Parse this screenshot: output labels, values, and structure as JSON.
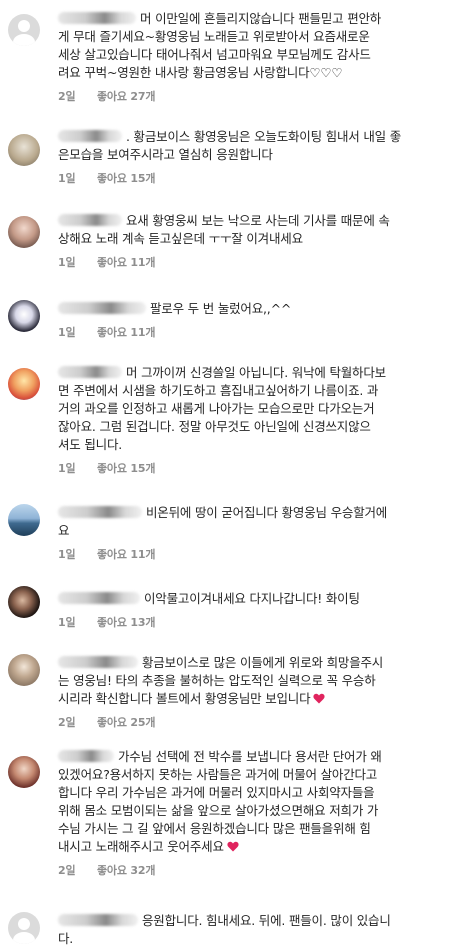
{
  "comments": [
    {
      "text": "머 이만일에 흔들리지않습니다 팬들믿고 편안하\n게 무대 즐기세요~황영웅님 노래듣고 위로받아서 요즘새로운\n세상 살고있습니다 태어나줘서 넘고마워요 부모님께도 감사드\n려요 꾸벅~영원한 내사랑 황금영웅님 사랑합니다♡♡♡",
      "time": "2일",
      "likes": "좋아요 27개"
    },
    {
      "text": ". 황금보이스 황영웅님은 오늘도화이팅 힘내서 내일 좋\n은모습을 보여주시라고 열심히 응원합니다",
      "time": "1일",
      "likes": "좋아요 15개"
    },
    {
      "text": "요새 황영웅씨 보는 낙으로 사는데 기사를 때문에 속\n상해요 노래 계속 듣고싶은데 ㅜㅜ잘 이겨내세요",
      "time": "1일",
      "likes": "좋아요 11개"
    },
    {
      "text": "팔로우 두 번 눌렀어요,,^^",
      "time": "1일",
      "likes": "좋아요 11개"
    },
    {
      "text": "머 그까이꺼 신경쓸일 아닙니다. 워낙에 탁월하다보\n면 주변에서 시샘을 하기도하고 흠집내고싶어하기 나름이죠. 과\n거의 과오를 인정하고 새롭게 나아가는 모습으로만 다가오는거\n잖아요. 그럼 된겁니다. 정말 아무것도 아닌일에 신경쓰지않으\n셔도 됩니다.",
      "time": "1일",
      "likes": "좋아요 15개"
    },
    {
      "text": "비온뒤에 땅이 굳어집니다 황영웅님 우승할거에\n요",
      "time": "1일",
      "likes": "좋아요 11개"
    },
    {
      "text": "이악물고이겨내세요 다지나갑니다! 화이팅",
      "time": "1일",
      "likes": "좋아요 13개"
    },
    {
      "text": "황금보이스로 많은 이들에게 위로와 희망을주시\n는 영웅님! 타의 추종을 불허하는 압도적인 실력으로 꼭 우승하\n시리라 확신합니다 볼트에서 황영웅님만 보입니다",
      "time": "2일",
      "likes": "좋아요 25개"
    },
    {
      "text": "가수님 선택에 전 박수를 보냅니다 용서란 단어가 왜\n있겠어요?용서하지 못하는 사람들은 과거에 머물어 살아간다고\n합니다 우리 가수님은 과거에 머물러 있지마시고 사회약자들을\n위해 몸소 모범이되는 삶을 앞으로 살아가셨으면해요 저희가 가\n수님 가시는 그 길 앞에서 응원하겠습니다 많은 팬들을위해 힘\n내시고 노래해주시고 웃어주세요",
      "time": "2일",
      "likes": "좋아요 32개"
    },
    {
      "text": "응원합니다. 힘내세요. 뒤에. 팬들이. 많이 있습니\n다.",
      "time": "",
      "likes": ""
    }
  ],
  "colors": {
    "text": "#262626",
    "meta": "#8e8e8e",
    "heart": "#e0245e"
  },
  "icons": {
    "heart": "heart-icon",
    "avatar": "avatar"
  }
}
